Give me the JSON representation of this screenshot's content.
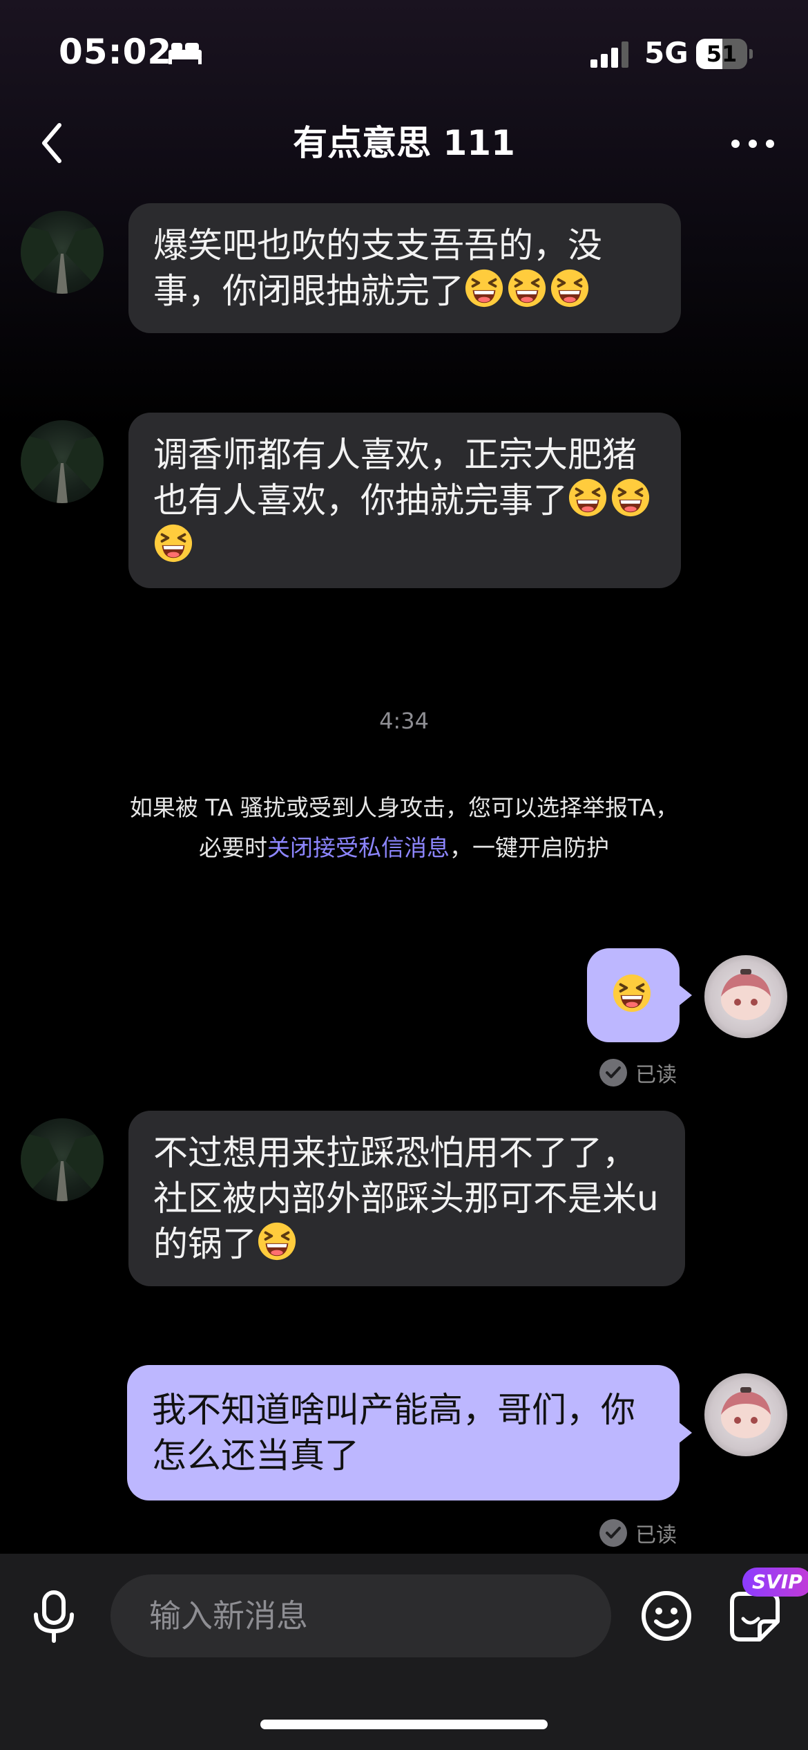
{
  "status_bar": {
    "time": "05:02",
    "network": "5G",
    "battery": "51",
    "battery_level": 0.51
  },
  "header": {
    "title": "有点意思 111"
  },
  "messages": [
    {
      "side": "in",
      "text": "爆笑吧也吹的支支吾吾的，没事，你闭眼抽就完了",
      "emoji": [
        "laughing-face",
        "laughing-face",
        "laughing-face"
      ]
    },
    {
      "side": "in",
      "text": "调香师都有人喜欢，正宗大肥猪也有人喜欢，你抽就完事了",
      "emoji": [
        "laughing-face",
        "laughing-face",
        "laughing-face"
      ]
    },
    {
      "side": "out",
      "text": "",
      "emoji": [
        "laughing-face"
      ],
      "status": "已读"
    },
    {
      "side": "in",
      "text": "不过想用来拉踩恐怕用不了了，社区被内部外部踩头那可不是米u的锅了",
      "emoji": [
        "laughing-face"
      ]
    },
    {
      "side": "out",
      "text": "我不知道啥叫产能高，哥们，你怎么还当真了",
      "emoji": [],
      "status": "已读"
    }
  ],
  "divider": {
    "timestamp": "4:34",
    "notice_line1": "如果被 TA 骚扰或受到人身攻击，您可以选择举报TA，",
    "notice_prefix": "必要时",
    "notice_link": "关闭接受私信消息",
    "notice_suffix": "，一键开启防护"
  },
  "input_bar": {
    "placeholder": "输入新消息",
    "badge": "SVIP"
  },
  "colors": {
    "outgoing_bubble": "#bdb7ff",
    "incoming_bubble": "#2b2b2e",
    "link": "#8d86ff",
    "badge": "#8b3cff"
  }
}
